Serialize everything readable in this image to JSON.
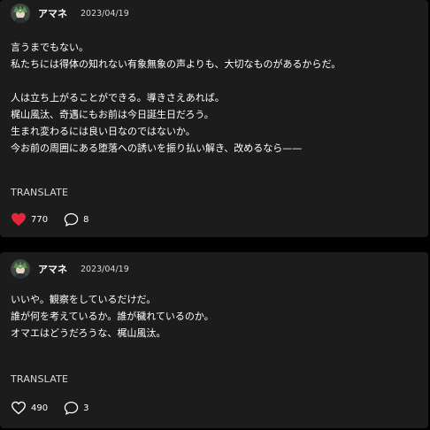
{
  "colors": {
    "background": "#000000",
    "card": "#1c1c1c",
    "liked_heart": "#e0283a",
    "text": "#ffffff"
  },
  "posts": [
    {
      "author": "アマネ",
      "date": "2023/04/19",
      "paragraphs": [
        [
          "言うまでもない。",
          "私たちには得体の知れない有象無象の声よりも、大切なものがあるからだ。"
        ],
        [
          "人は立ち上がることができる。導きさえあれば。",
          "梶山風汰、奇遇にもお前は今日誕生日だろう。",
          "生まれ変わるには良い日なのではないか。",
          "今お前の周囲にある堕落への誘いを振り払い解き、改めるなら——"
        ]
      ],
      "translate_label": "TRANSLATE",
      "likes": "770",
      "comments": "8",
      "liked": true
    },
    {
      "author": "アマネ",
      "date": "2023/04/19",
      "paragraphs": [
        [
          "いいや。観察をしているだけだ。",
          "誰が何を考えているか。誰が穢れているのか。",
          "オマエはどうだろうな、梶山風汰。"
        ]
      ],
      "translate_label": "TRANSLATE",
      "likes": "490",
      "comments": "3",
      "liked": false
    }
  ]
}
